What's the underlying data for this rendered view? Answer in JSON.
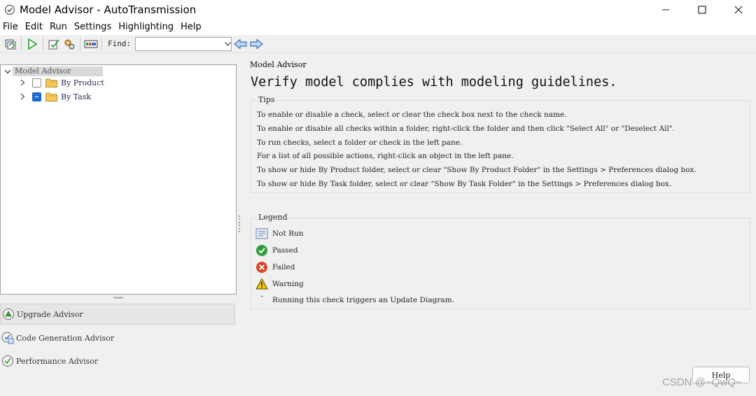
{
  "window": {
    "title": "Model Advisor - AutoTransmission",
    "controls": [
      "minimize-icon",
      "maximize-icon",
      "close-icon"
    ]
  },
  "menu": [
    "File",
    "Edit",
    "Run",
    "Settings",
    "Highlighting",
    "Help"
  ],
  "toolbar": {
    "buttons": [
      "refresh-icon",
      "run-icon",
      "select-checks-icon",
      "settings-gear-icon",
      "report-icon"
    ],
    "find_label": "Find:",
    "find_value": "",
    "nav_buttons": [
      "back-arrow-icon",
      "forward-arrow-icon"
    ]
  },
  "tree": {
    "root": "Model Advisor",
    "items": [
      {
        "label": "By Product",
        "state": "unchecked"
      },
      {
        "label": "By Task",
        "state": "partial"
      }
    ]
  },
  "advisors": [
    "Upgrade Advisor",
    "Code Generation Advisor",
    "Performance Advisor"
  ],
  "main": {
    "label": "Model Advisor",
    "heading": "Verify model complies with modeling guidelines.",
    "tips": {
      "title": "Tips",
      "lines": [
        "To enable or disable a check, select or clear the check box next to the check name.",
        "To enable or disable all checks within a folder, right-click the folder and then click \"Select All\" or \"Deselect All\".",
        "To run checks, select a folder or check in the left pane.",
        "For a list of all possible actions, right-click an object in the left pane.",
        "To show or hide By Product folder, select or clear \"Show By Product Folder\" in the Settings > Preferences dialog box.",
        "To show or hide By Task folder, select or clear \"Show By Task Folder\" in the Settings > Preferences dialog box."
      ]
    },
    "legend": {
      "title": "Legend",
      "items": [
        {
          "icon": "not-run-icon",
          "label": "Not Run"
        },
        {
          "icon": "passed-icon",
          "label": "Passed"
        },
        {
          "icon": "failed-icon",
          "label": "Failed"
        },
        {
          "icon": "warning-icon",
          "label": "Warning"
        },
        {
          "icon": "asterisk-marker",
          "label": "Running this check triggers an Update Diagram."
        }
      ]
    }
  },
  "help_button": "Help",
  "watermark": "CSDN @~QwQ~",
  "colors": {
    "passed": "#2e9e3e",
    "failed": "#d9452a",
    "warning": "#f2c400",
    "checkbox_partial": "#1f6cd0",
    "run_green": "#3aa63a"
  }
}
